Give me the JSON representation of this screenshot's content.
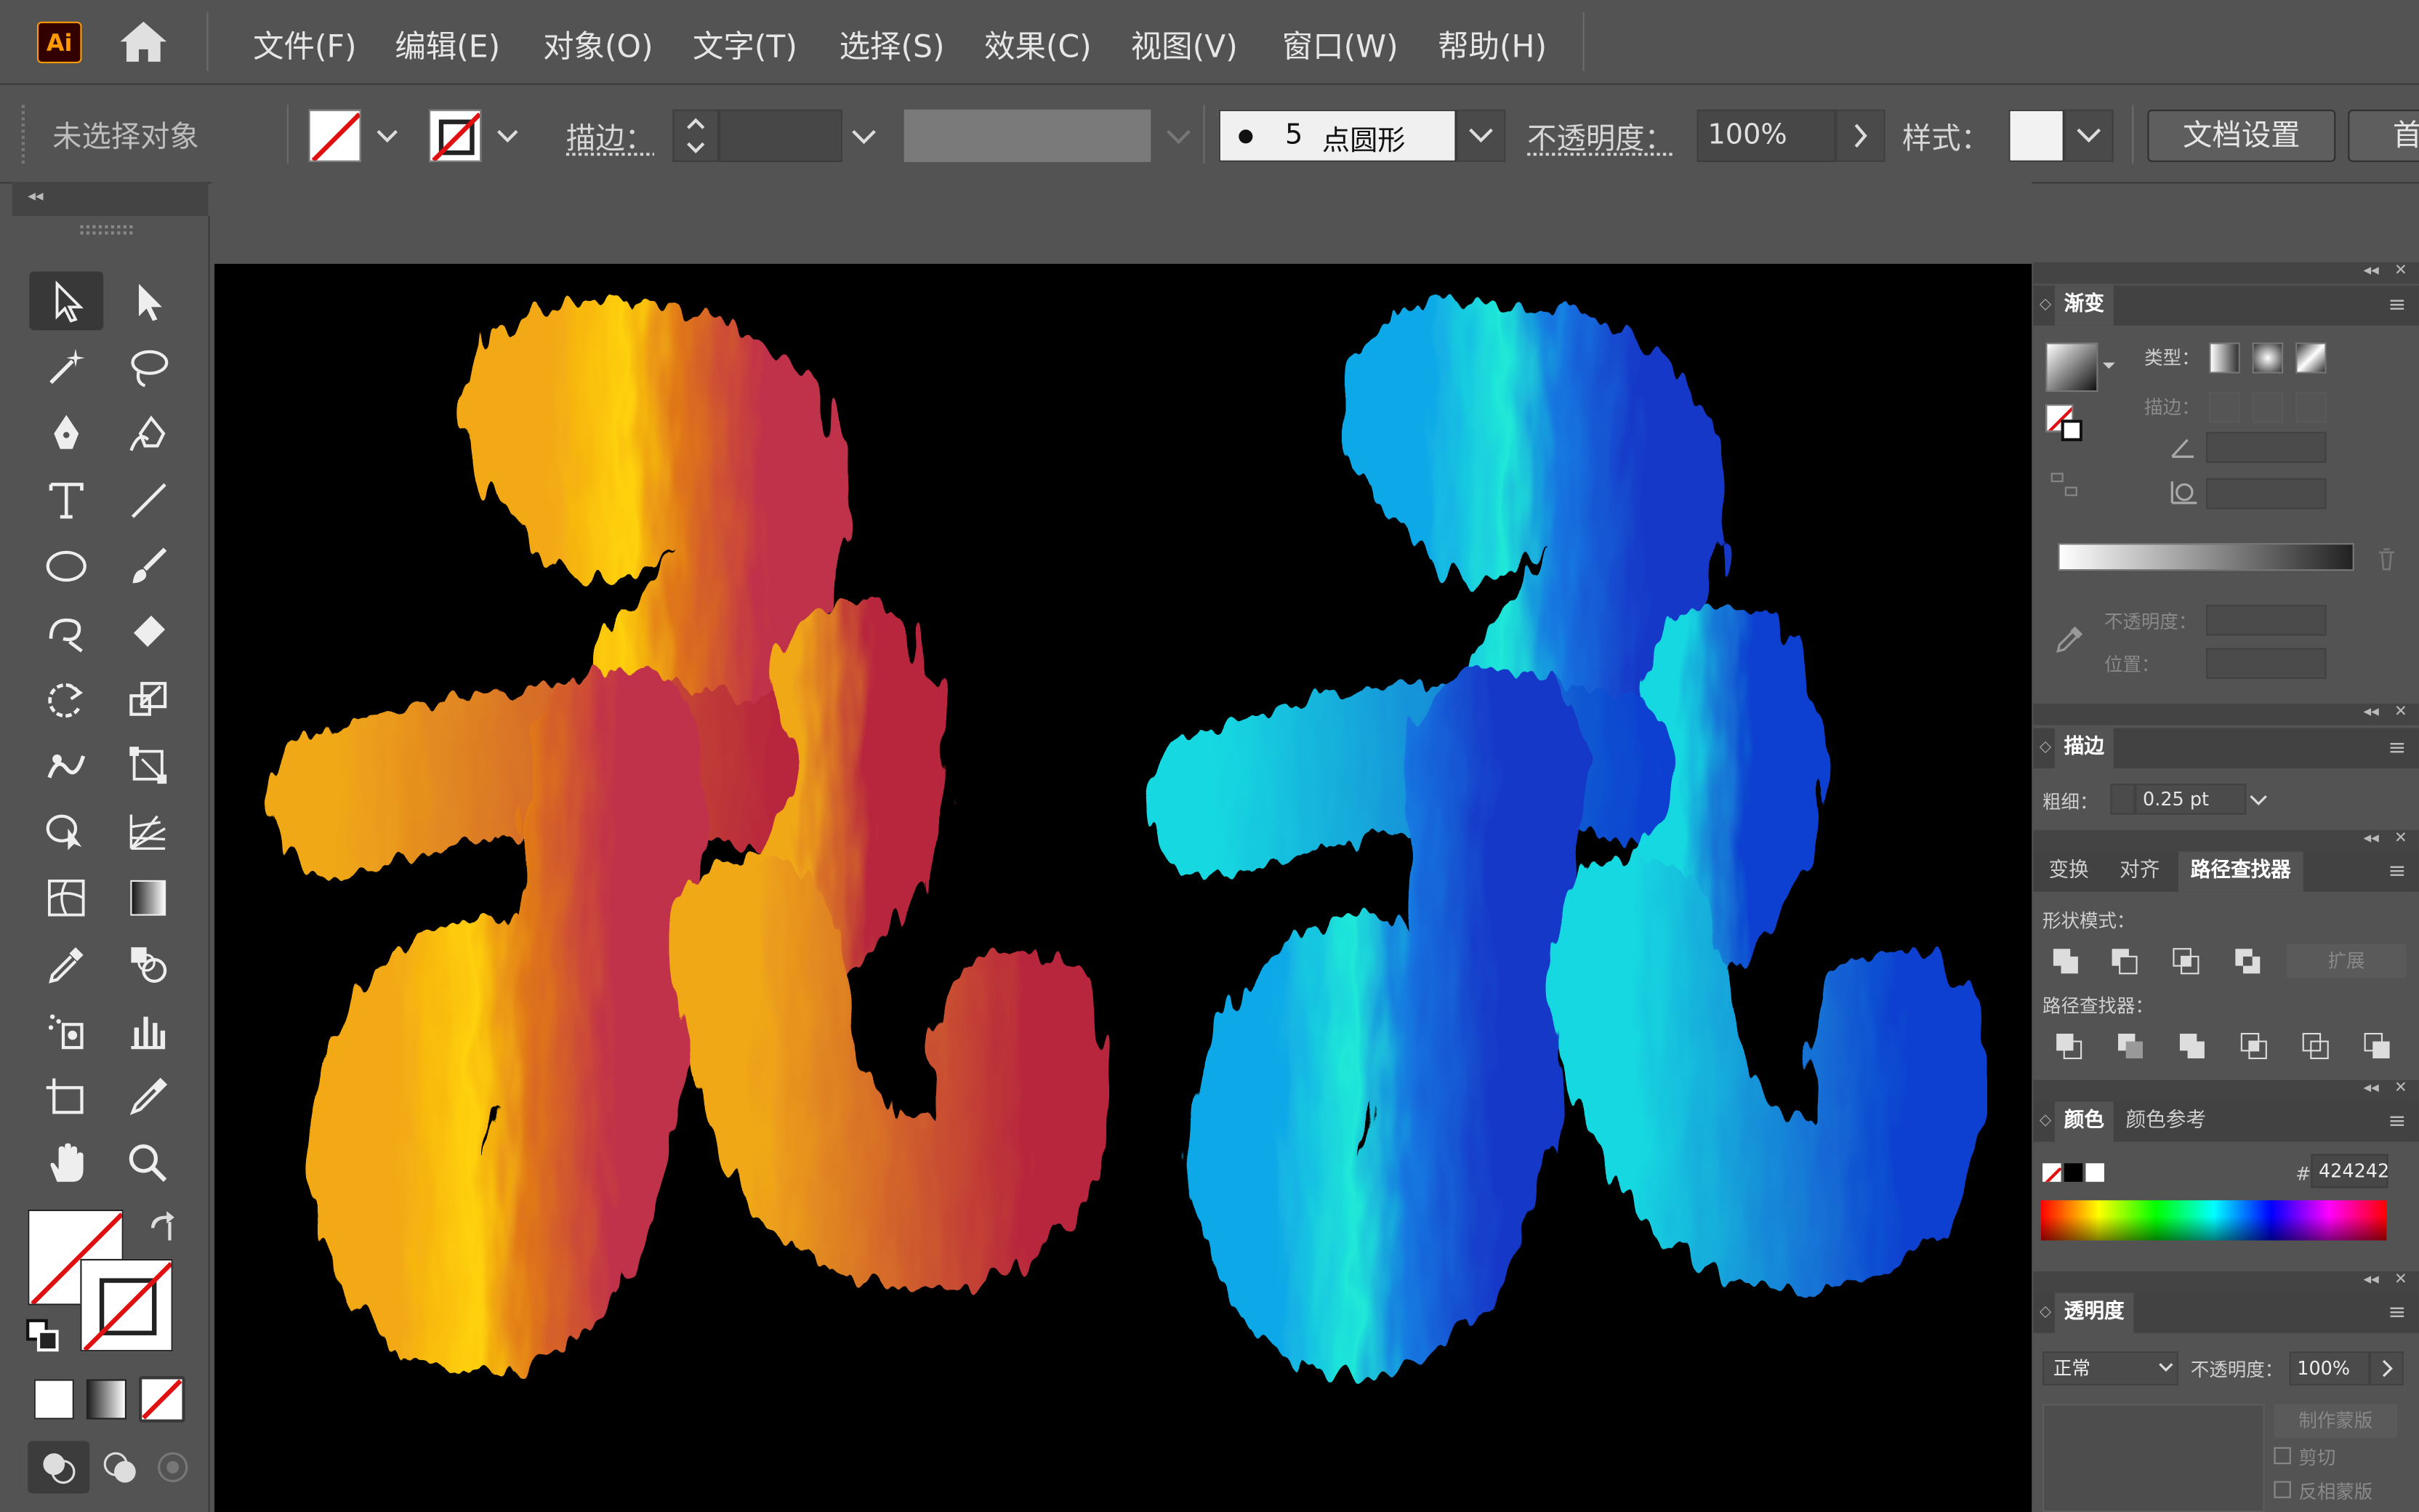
{
  "app": {
    "logo_text": "Ai",
    "home_icon": "home-icon"
  },
  "menu": [
    "文件(F)",
    "编辑(E)",
    "对象(O)",
    "文字(T)",
    "选择(S)",
    "效果(C)",
    "视图(V)",
    "窗口(W)",
    "帮助(H)"
  ],
  "control": {
    "no_selection": "未选择对象",
    "stroke_label": "描边：",
    "brush_size": "5",
    "brush_name": "点圆形",
    "opacity_label": "不透明度：",
    "opacity_value": "100%",
    "style_label": "样式：",
    "doc_setup": "文档设置",
    "prefs_cut": "首"
  },
  "panels": {
    "gradient": {
      "title": "渐变",
      "type_label": "类型：",
      "stroke_label": "描边：",
      "opacity_label": "不透明度：",
      "position_label": "位置："
    },
    "stroke": {
      "title": "描边",
      "weight_label": "粗细：",
      "weight_value": "0.25 pt"
    },
    "pathfinder": {
      "tabs": [
        "变换",
        "对齐",
        "路径查找器"
      ],
      "shape_modes_label": "形状模式：",
      "expand_label": "扩展",
      "pathfinders_label": "路径查找器："
    },
    "color": {
      "tabs": [
        "颜色",
        "颜色参考"
      ],
      "hash": "#",
      "hex_value": "424242"
    },
    "transparency": {
      "title": "透明度",
      "blend_mode": "正常",
      "opacity_label": "不透明度：",
      "opacity_value": "100%",
      "make_mask": "制作蒙版",
      "clip_label": "剪切",
      "invert_label": "反相蒙版"
    }
  },
  "colors": {
    "ui_bg": "#535353",
    "artboard": "#000000",
    "warm_gradient": [
      "#ffd000",
      "#f0a010",
      "#c8303a"
    ],
    "cool_gradient": [
      "#20f0e0",
      "#10b0e8",
      "#1040d0"
    ]
  }
}
